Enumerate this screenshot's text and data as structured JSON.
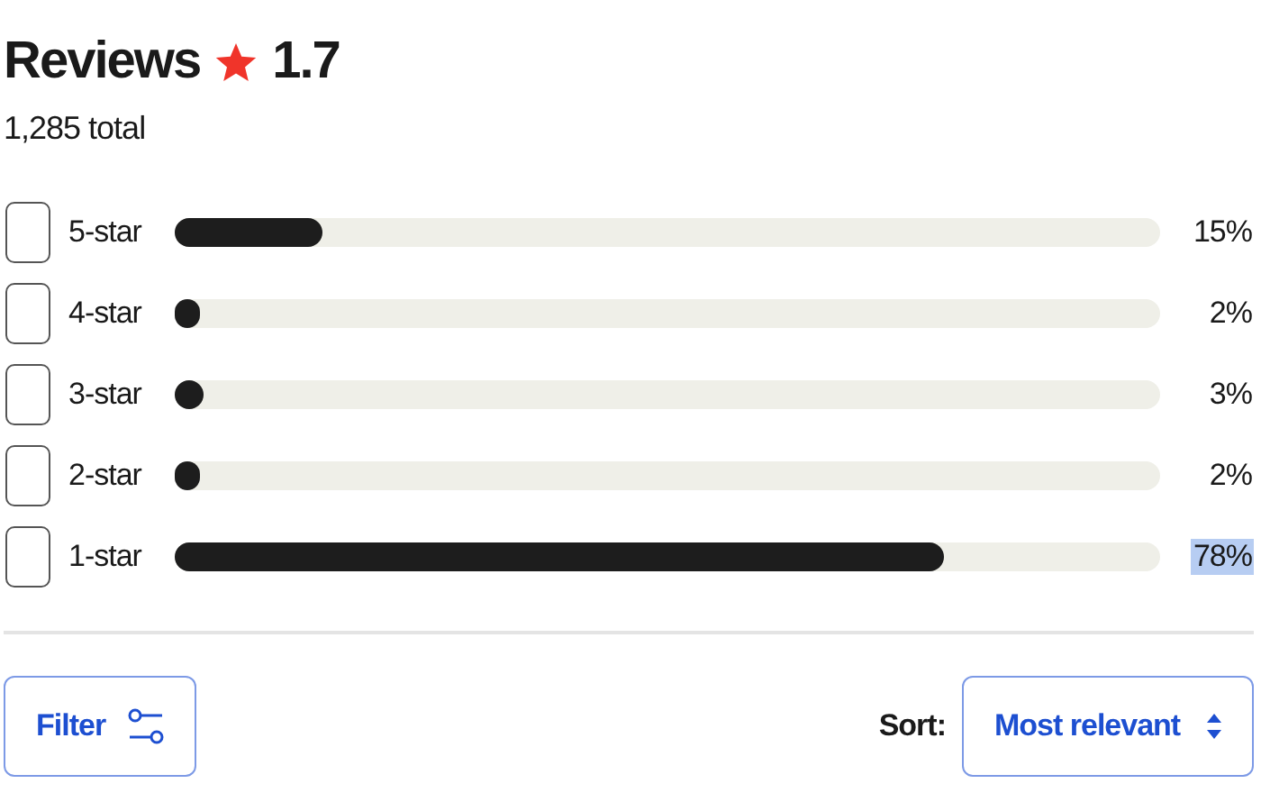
{
  "header": {
    "title": "Reviews",
    "rating": "1.7",
    "total": "1,285 total"
  },
  "rows": [
    {
      "label": "5-star",
      "checked": false,
      "level": 0.15,
      "percent": "15%",
      "highlighted": false
    },
    {
      "label": "4-star",
      "checked": false,
      "level": 0.02,
      "percent": "2%",
      "highlighted": false
    },
    {
      "label": "3-star",
      "checked": false,
      "level": 0.03,
      "percent": "3%",
      "highlighted": false
    },
    {
      "label": "2-star",
      "checked": false,
      "level": 0.02,
      "percent": "2%",
      "highlighted": false
    },
    {
      "label": "1-star",
      "checked": false,
      "level": 0.78,
      "percent": "78%",
      "highlighted": true
    }
  ],
  "filter": {
    "label": "Filter"
  },
  "sort": {
    "label": "Sort:",
    "value": "Most relevant"
  }
}
